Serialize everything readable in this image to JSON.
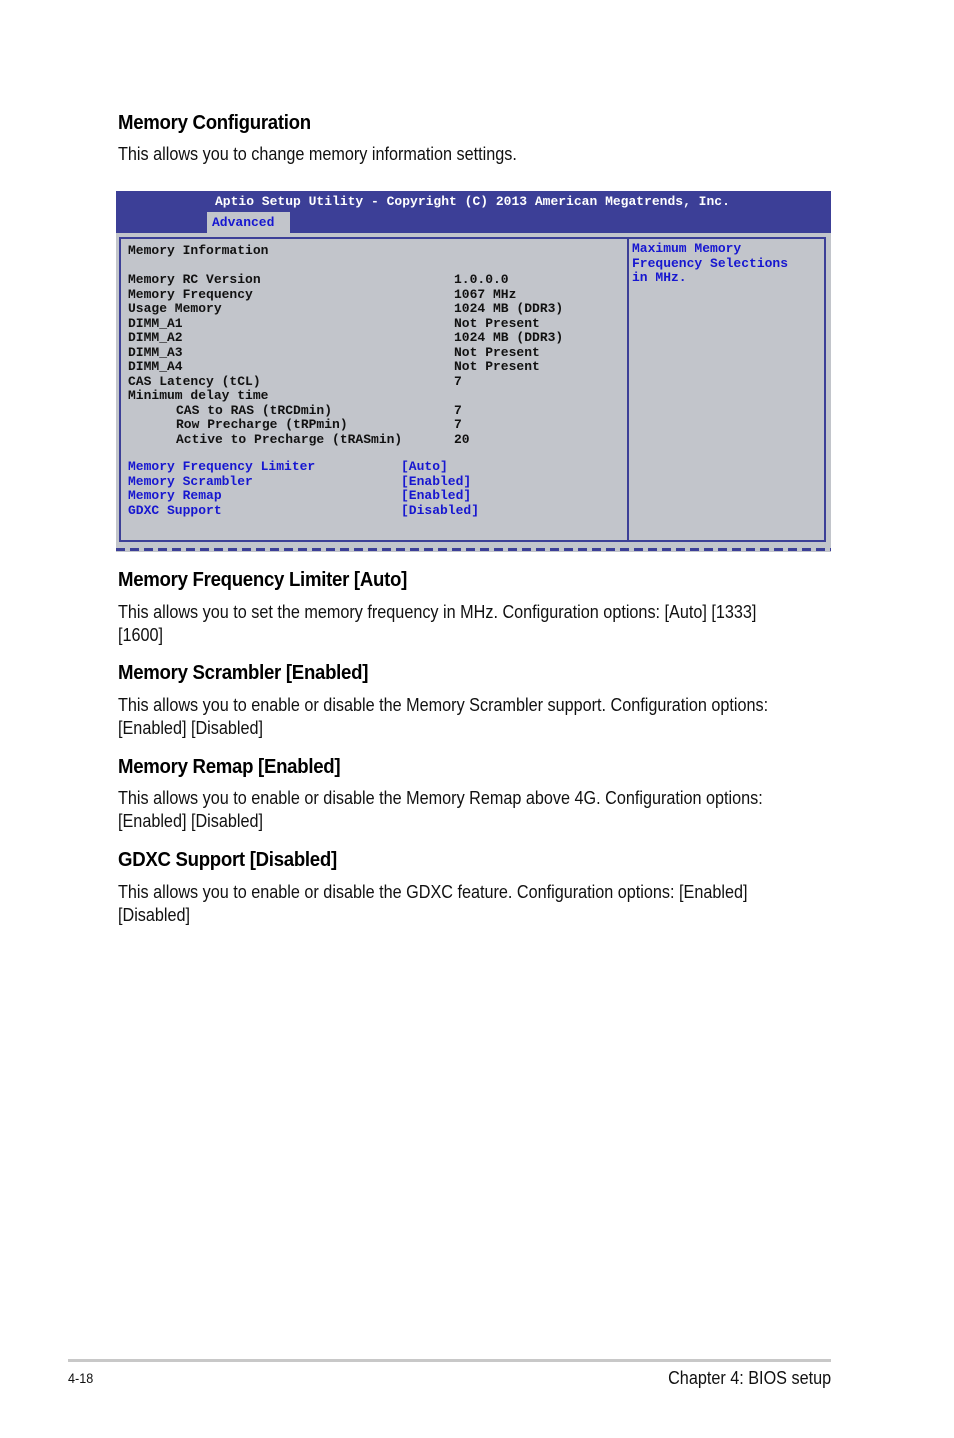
{
  "section": {
    "title": "Memory Configuration",
    "intro": "This allows you to change memory information settings."
  },
  "bios": {
    "title": "Aptio Setup Utility - Copyright (C) 2013 American Megatrends, Inc.",
    "active_tab": "Advanced",
    "section_heading": "Memory Information",
    "info_rows": [
      {
        "label": "Memory RC Version",
        "value": "1.0.0.0"
      },
      {
        "label": "Memory Frequency",
        "value": "1067 MHz"
      },
      {
        "label": "Usage Memory",
        "value": "1024 MB (DDR3)"
      },
      {
        "label": "DIMM_A1",
        "value": "Not Present"
      },
      {
        "label": "DIMM_A2",
        "value": "1024 MB (DDR3)"
      },
      {
        "label": "DIMM_A3",
        "value": "Not Present"
      },
      {
        "label": "DIMM_A4",
        "value": "Not Present"
      },
      {
        "label": "CAS Latency (tCL)",
        "value": "7"
      },
      {
        "label": "Minimum delay time",
        "value": ""
      },
      {
        "label": "CAS to RAS (tRCDmin)",
        "value": "7"
      },
      {
        "label": "Row Precharge (tRPmin)",
        "value": "7"
      },
      {
        "label": "Active to Precharge (tRASmin)",
        "value": "20"
      }
    ],
    "settings": [
      {
        "label": "Memory Frequency Limiter",
        "value": "[Auto]"
      },
      {
        "label": "Memory Scrambler",
        "value": "[Enabled]"
      },
      {
        "label": "Memory Remap",
        "value": "[Enabled]"
      },
      {
        "label": "GDXC Support",
        "value": "[Disabled]"
      }
    ],
    "help_text": "Maximum Memory\nFrequency Selections\nin MHz.",
    "colors": {
      "header": "#3c3f97",
      "panel": "#c2c5cb",
      "highlight": "#1616d0"
    }
  },
  "items": [
    {
      "heading": "Memory Frequency Limiter [Auto]",
      "description": "This allows you to set the memory frequency in MHz. Configuration options: [Auto] [1333] [1600]"
    },
    {
      "heading": "Memory Scrambler [Enabled]",
      "description": "This allows you to enable or disable the Memory Scrambler support. Configuration options: [Enabled] [Disabled]"
    },
    {
      "heading": "Memory Remap [Enabled]",
      "description": "This allows you to enable or disable the Memory Remap above 4G. Configuration options: [Enabled] [Disabled]"
    },
    {
      "heading": "GDXC Support [Disabled]",
      "description": "This allows you to enable or disable the GDXC feature. Configuration options: [Enabled] [Disabled]"
    }
  ],
  "footer": {
    "page_number": "4-18",
    "chapter": "Chapter 4: BIOS setup"
  }
}
